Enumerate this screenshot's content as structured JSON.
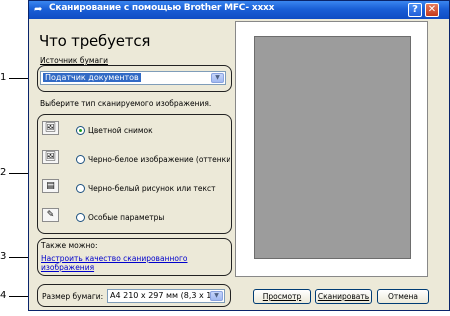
{
  "window": {
    "title": "Сканирование с помощью Brother MFC- xxxx",
    "help_label": "?",
    "close_label": "✕"
  },
  "heading": "Что требуется",
  "source": {
    "label": "Источник бумаги",
    "value": "Податчик документов"
  },
  "type_prompt": "Выберите тип сканируемого изображения.",
  "scan_types": [
    {
      "label": "Цветной снимок",
      "selected": true,
      "icon": "color-photo-icon"
    },
    {
      "label": "Черно-белое изображение (оттенки",
      "selected": false,
      "icon": "grayscale-photo-icon"
    },
    {
      "label": "Черно-белый рисунок или текст",
      "selected": false,
      "icon": "text-document-icon"
    },
    {
      "label": "Особые параметры",
      "selected": false,
      "icon": "custom-settings-icon"
    }
  ],
  "also": {
    "label": "Также можно:",
    "link_line1": "Настроить качество сканированного",
    "link_line2": "изображения"
  },
  "paper_size": {
    "label": "Размер бумаги:",
    "value": "A4 210 x 297 мм (8,3 x 11,"
  },
  "buttons": {
    "preview": "Просмотр",
    "scan": "Сканировать",
    "cancel": "Отмена"
  },
  "callouts": [
    "1",
    "2",
    "3",
    "4"
  ],
  "colors": {
    "titlebar": "#0f4cc4",
    "selection": "#316ac5",
    "link": "#0000cc",
    "preview_paper": "#9c9c9c"
  }
}
